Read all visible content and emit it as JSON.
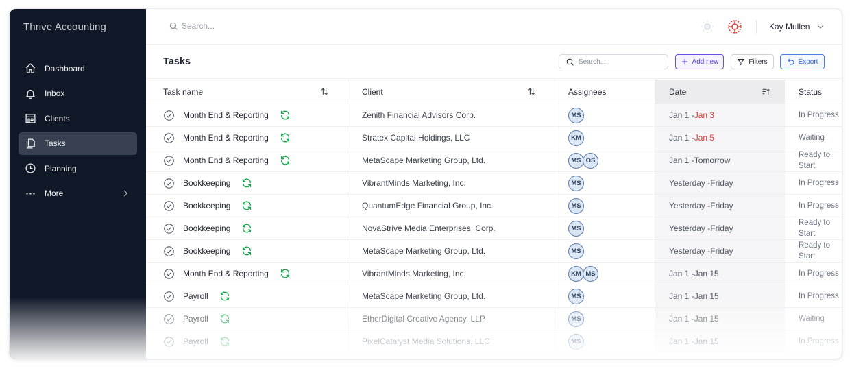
{
  "app": {
    "title": "Thrive Accounting"
  },
  "colors": {
    "sidebar_bg": "#111827",
    "accent_purple": "#5b3fd4",
    "accent_blue": "#2b61d6",
    "due_red": "#e53935",
    "sync_green": "#16a34a"
  },
  "sidebar": {
    "items": [
      {
        "label": "Dashboard",
        "icon": "home-icon"
      },
      {
        "label": "Inbox",
        "icon": "bell-icon"
      },
      {
        "label": "Clients",
        "icon": "building-icon"
      },
      {
        "label": "Tasks",
        "icon": "copy-icon",
        "active": true
      },
      {
        "label": "Planning",
        "icon": "clock-icon"
      },
      {
        "label": "More",
        "icon": "ellipsis-icon"
      }
    ]
  },
  "topbar": {
    "search_placeholder": "Search...",
    "user_name": "Kay Mullen"
  },
  "page": {
    "title": "Tasks"
  },
  "toolbar": {
    "search_placeholder": "Search...",
    "add_label": "Add new",
    "filters_label": "Filters",
    "export_label": "Export"
  },
  "table": {
    "columns": {
      "task": "Task name",
      "client": "Client",
      "assignees": "Assignees",
      "date": "Date",
      "status": "Status"
    },
    "rows": [
      {
        "task": "Month End & Reporting",
        "client": "Zenith Financial Advisors Corp.",
        "assignees": [
          "MS"
        ],
        "date_start": "Jan 1 - ",
        "date_end": "Jan 3",
        "date_end_overdue": true,
        "status": "In Progress"
      },
      {
        "task": "Month End & Reporting",
        "client": "Stratex Capital Holdings, LLC",
        "assignees": [
          "KM"
        ],
        "date_start": "Jan 1 - ",
        "date_end": "Jan 5",
        "date_end_overdue": true,
        "status": "Waiting"
      },
      {
        "task": "Month End & Reporting",
        "client": "MetaScape Marketing Group, Ltd.",
        "assignees": [
          "MS",
          "OS"
        ],
        "date_start": "Jan 1 - ",
        "date_end": "Tomorrow",
        "date_end_overdue": false,
        "status": "Ready to Start"
      },
      {
        "task": "Bookkeeping",
        "client": "VibrantMinds Marketing, Inc.",
        "assignees": [
          "MS"
        ],
        "date_start": "Yesterday - ",
        "date_end": "Friday",
        "date_end_overdue": false,
        "status": "In Progress"
      },
      {
        "task": "Bookkeeping",
        "client": "QuantumEdge Financial Group, Inc.",
        "assignees": [
          "MS"
        ],
        "date_start": "Yesterday - ",
        "date_end": "Friday",
        "date_end_overdue": false,
        "status": "In Progress"
      },
      {
        "task": "Bookkeeping",
        "client": "NovaStrive Media Enterprises, Corp.",
        "assignees": [
          "MS"
        ],
        "date_start": "Yesterday - ",
        "date_end": "Friday",
        "date_end_overdue": false,
        "status": "Ready to Start"
      },
      {
        "task": "Bookkeeping",
        "client": "MetaScape Marketing Group, Ltd.",
        "assignees": [
          "MS"
        ],
        "date_start": "Yesterday - ",
        "date_end": "Friday",
        "date_end_overdue": false,
        "status": "Ready to Start"
      },
      {
        "task": "Month End & Reporting",
        "client": "VibrantMinds Marketing, Inc.",
        "assignees": [
          "KM",
          "MS"
        ],
        "date_start": "Jan 1 - ",
        "date_end": "Jan 15",
        "date_end_overdue": false,
        "status": "In Progress"
      },
      {
        "task": "Payroll",
        "client": "MetaScape Marketing Group, Ltd.",
        "assignees": [
          "MS"
        ],
        "date_start": "Jan 1 - ",
        "date_end": "Jan 15",
        "date_end_overdue": false,
        "status": "In Progress"
      },
      {
        "task": "Payroll",
        "client": "EtherDigital Creative Agency, LLP",
        "assignees": [
          "MS"
        ],
        "date_start": "Jan 1 - ",
        "date_end": "Jan 15",
        "date_end_overdue": false,
        "status": "Waiting"
      },
      {
        "task": "Payroll",
        "client": "PixelCatalyst Media Solutions, LLC",
        "assignees": [
          "MS"
        ],
        "date_start": "Jan 1 - ",
        "date_end": "Jan 15",
        "date_end_overdue": false,
        "status": "In Progress"
      }
    ]
  }
}
